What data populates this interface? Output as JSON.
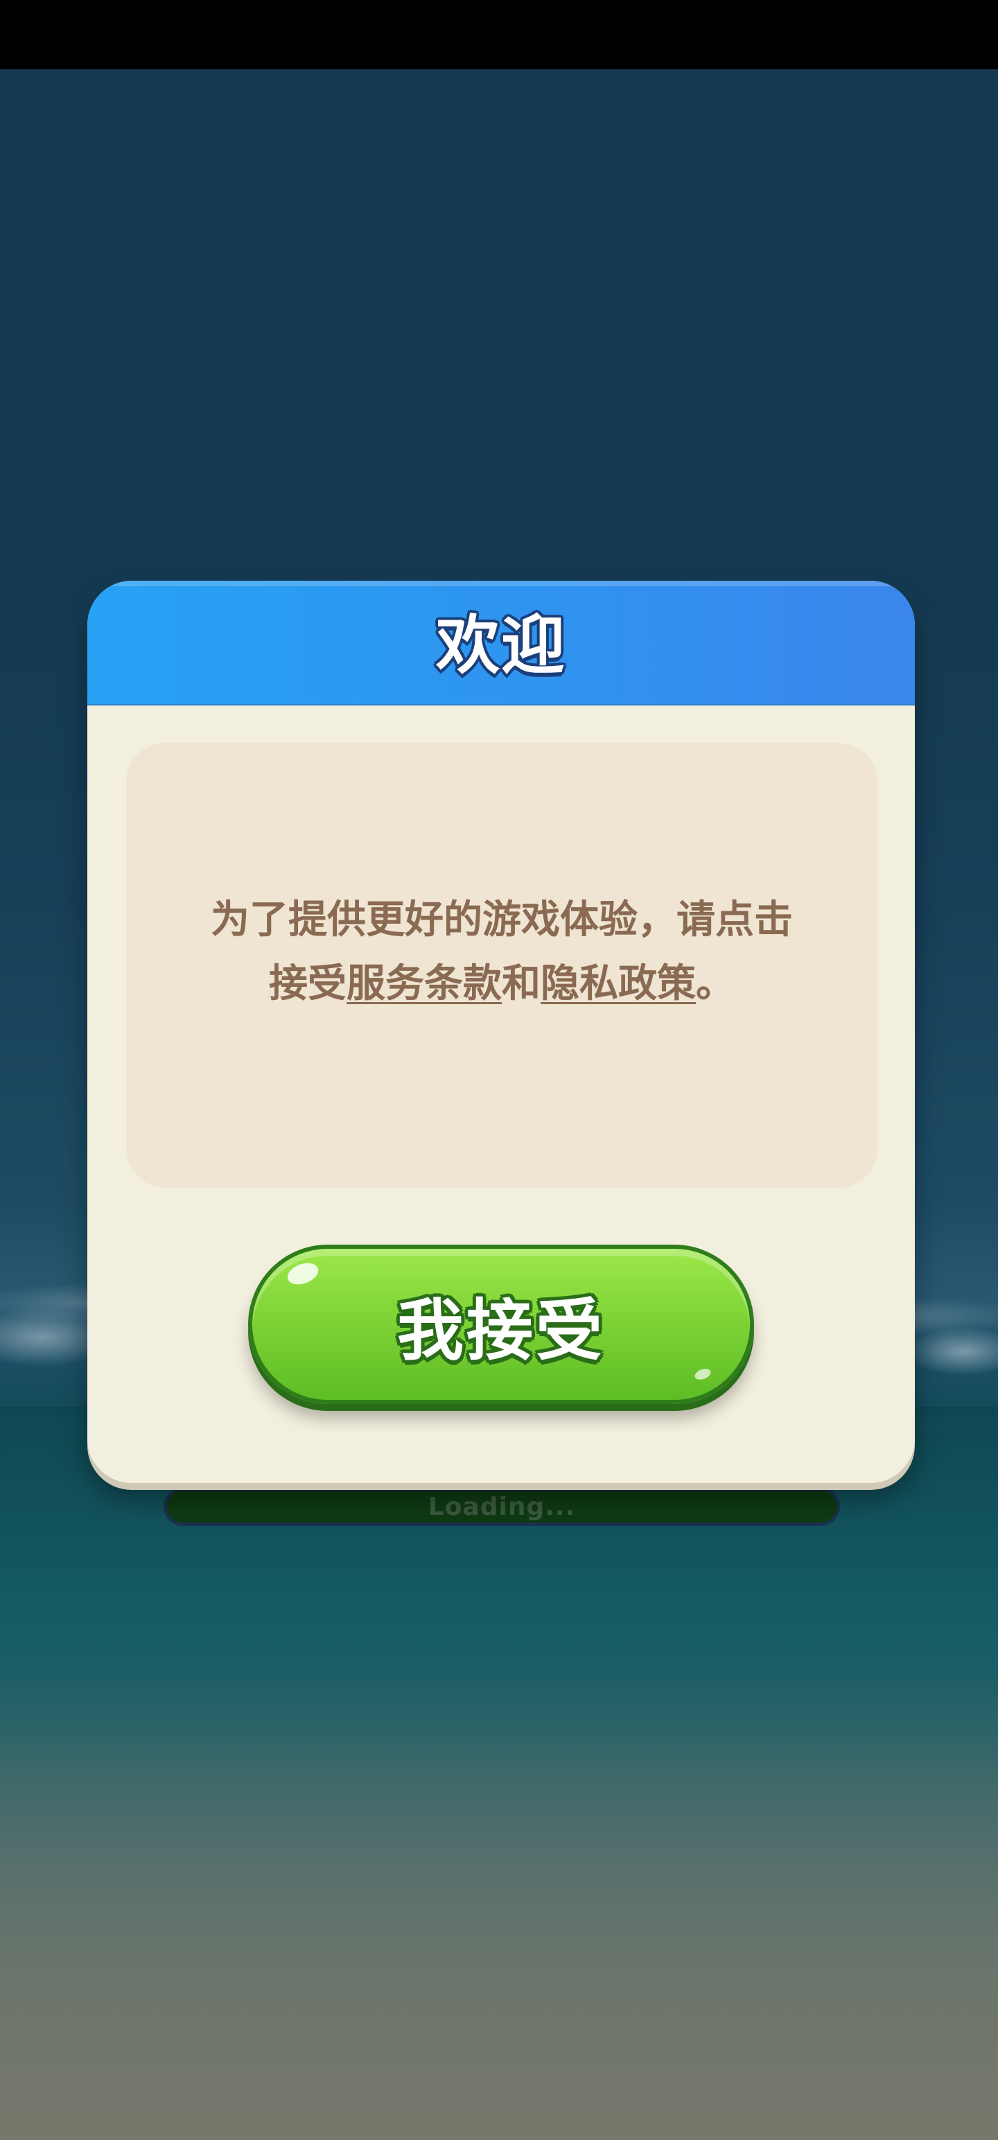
{
  "dialog": {
    "title": "欢迎",
    "message": {
      "line1": "为了提供更好的游戏体验，请点击",
      "line2_prefix": "接受",
      "terms_link": "服务条款",
      "conjunction": "和",
      "privacy_link": "隐私政策",
      "suffix": "。"
    },
    "accept_button": "我接受"
  },
  "loading": {
    "label": "Loading..."
  },
  "colors": {
    "header_blue": "#2e95f0",
    "panel_cream": "#f3efdf",
    "message_panel": "#efe5d2",
    "text_brown": "#8a6a52",
    "button_green": "#7fd436",
    "button_outline": "#2f7d1a"
  }
}
